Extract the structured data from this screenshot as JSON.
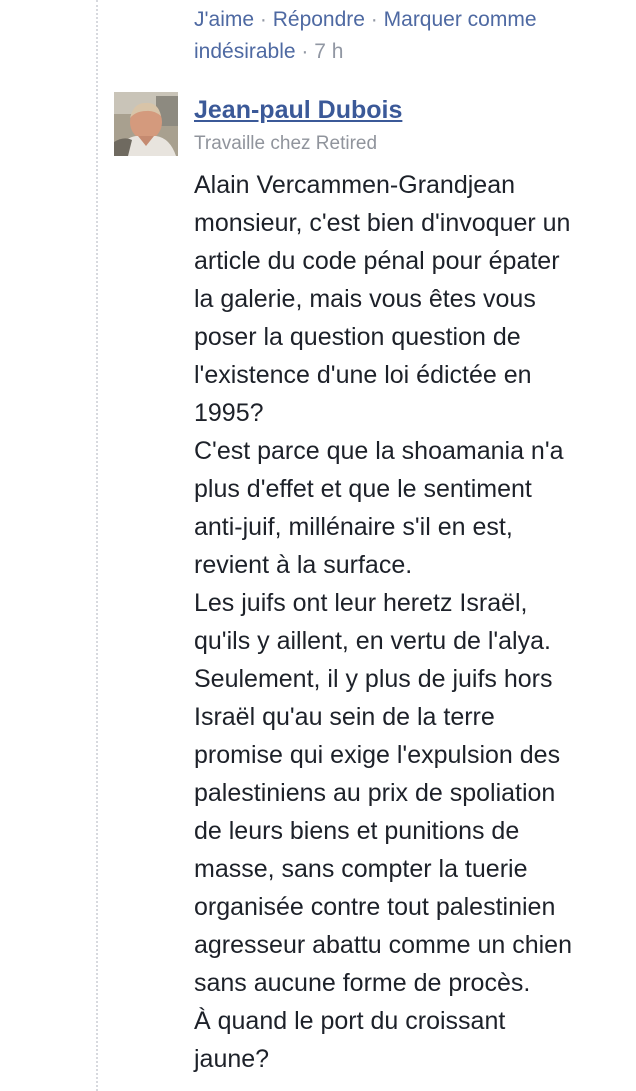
{
  "previous_comment_actions": {
    "like": "J'aime",
    "reply": "Répondre",
    "mark_spam_line1": "Marquer comme",
    "mark_spam_line2": "indésirable",
    "separator": "·",
    "time": "7 h"
  },
  "comment": {
    "author": "Jean-paul Dubois",
    "author_work": "Travaille chez Retired",
    "lines": [
      "Alain Vercammen-Grandjean",
      "monsieur, c'est bien d'invoquer un",
      "article du code pénal pour épater",
      "la galerie, mais vous êtes vous",
      "poser la question question de",
      "l'existence d'une loi édictée en",
      "1995?",
      "C'est parce que la shoamania n'a",
      "plus d'effet et que le sentiment",
      "anti-juif, millénaire s'il en est,",
      "revient à la surface.",
      "Les juifs ont leur heretz Israël,",
      "qu'ils y aillent, en vertu de l'alya.",
      "Seulement, il y plus de juifs hors",
      "Israël qu'au sein de la terre",
      "promise qui exige l'expulsion des",
      "palestiniens au prix de spoliation",
      "de leurs biens et punitions de",
      "masse, sans compter la tuerie",
      "organisée contre tout palestinien",
      "agresseur abattu comme un chien",
      "sans aucune forme de procès.",
      "À quand le port du croissant",
      "jaune?"
    ]
  }
}
